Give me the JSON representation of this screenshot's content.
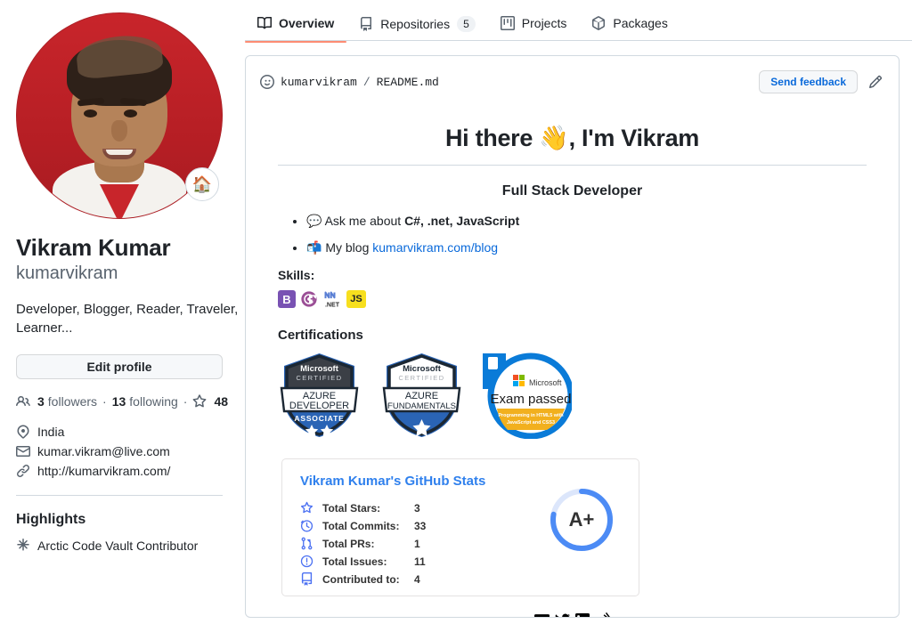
{
  "nav": {
    "tabs": [
      {
        "label": "Overview",
        "icon": "book-icon",
        "active": true,
        "count": null
      },
      {
        "label": "Repositories",
        "icon": "repo-icon",
        "active": false,
        "count": "5"
      },
      {
        "label": "Projects",
        "icon": "project-icon",
        "active": false,
        "count": null
      },
      {
        "label": "Packages",
        "icon": "package-icon",
        "active": false,
        "count": null
      }
    ]
  },
  "profile": {
    "avatar_alt": "Vikram Kumar profile photo",
    "status_emoji": "🏠",
    "full_name": "Vikram Kumar",
    "username": "kumarvikram",
    "bio": "Developer, Blogger, Reader, Traveler, Learner...",
    "edit_label": "Edit profile",
    "followers_count": "3",
    "followers_label": "followers",
    "following_count": "13",
    "following_label": "following",
    "stars_count": "48",
    "separator": "·",
    "details": [
      {
        "icon": "location-icon",
        "text": "India"
      },
      {
        "icon": "mail-icon",
        "text": "kumar.vikram@live.com"
      },
      {
        "icon": "link-icon",
        "text": "http://kumarvikram.com/"
      }
    ],
    "highlights_title": "Highlights",
    "highlights": [
      {
        "icon": "arctic-vault-icon",
        "text": "Arctic Code Vault Contributor"
      }
    ]
  },
  "readme": {
    "owner": "kumarvikram",
    "slash": "/",
    "file": "README.md",
    "smiley_icon": "smiley-icon",
    "feedback_label": "Send feedback",
    "edit_icon": "pencil-icon",
    "heading": "Hi there 👋, I'm Vikram",
    "subheading": "Full Stack Developer",
    "bullets": [
      {
        "emoji": "💬",
        "prefix": "Ask me about ",
        "bold": "C#, .net, JavaScript",
        "suffix": "",
        "link_text": "",
        "link_url": ""
      },
      {
        "emoji": "📬",
        "prefix": "My blog ",
        "bold": "",
        "suffix": "",
        "link_text": "kumarvikram.com/blog",
        "link_url": "kumarvikram.com/blog"
      }
    ],
    "skills_label": "Skills:",
    "skills": [
      {
        "name": "Bootstrap",
        "short": "B",
        "bg": "#7952b3",
        "fg": "#ffffff"
      },
      {
        "name": "C Sharp",
        "short": "C",
        "bg": "#ffffff",
        "fg": "#9b4f96"
      },
      {
        "name": ".NET",
        "short": ".NET",
        "bg": "#ffffff",
        "fg": "#512bd4"
      },
      {
        "name": "JavaScript",
        "short": "JS",
        "bg": "#f7df1e",
        "fg": "#1f2328"
      }
    ],
    "certifications_label": "Certifications",
    "certifications": [
      {
        "name": "azure-developer-associate-badge",
        "vendor": "Microsoft",
        "certified": "CERTIFIED",
        "line1": "AZURE",
        "line2": "DEVELOPER",
        "level": "ASSOCIATE",
        "stars": 2
      },
      {
        "name": "azure-fundamentals-badge",
        "vendor": "Microsoft",
        "certified": "CERTIFIED",
        "line1": "AZURE",
        "line2": "FUNDAMENTALS",
        "level": "",
        "stars": 1
      },
      {
        "name": "exam-passed-badge",
        "vendor": "Microsoft",
        "title": "Exam passed",
        "subtitle": "Programming in HTML5 with JavaScript and CSS3"
      }
    ]
  },
  "stats_card": {
    "title": "Vikram Kumar's GitHub Stats",
    "rows": [
      {
        "icon": "star-icon",
        "label": "Total Stars:",
        "value": "3"
      },
      {
        "icon": "clock-icon",
        "label": "Total Commits:",
        "value": "33"
      },
      {
        "icon": "pull-request-icon",
        "label": "Total PRs:",
        "value": "1"
      },
      {
        "icon": "issue-icon",
        "label": "Total Issues:",
        "value": "11"
      },
      {
        "icon": "repo-icon",
        "label": "Contributed to:",
        "value": "4"
      }
    ],
    "grade": "A+",
    "ring_percent": 78,
    "ring_color": "#4c8bf5",
    "ring_track_color": "#dce6fb",
    "title_color": "#2f80ed"
  },
  "socials": [
    {
      "name": "devto-icon",
      "label": "DEV"
    },
    {
      "name": "twitter-icon",
      "label": "Twitter"
    },
    {
      "name": "linkedin-icon",
      "label": "LinkedIn"
    },
    {
      "name": "stackoverflow-icon",
      "label": "Stack Overflow"
    }
  ]
}
